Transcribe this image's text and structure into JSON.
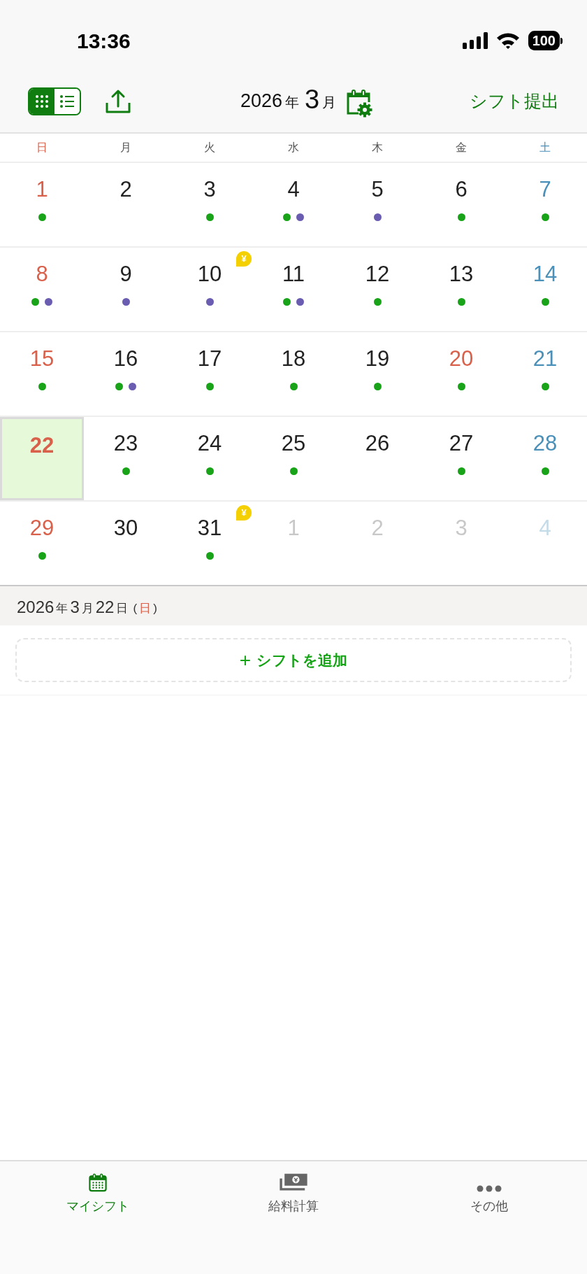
{
  "status_bar": {
    "time": "13:36",
    "battery": "100"
  },
  "header": {
    "view_toggle": [
      {
        "kind": "grid",
        "selected": true
      },
      {
        "kind": "list",
        "selected": false
      }
    ],
    "year": "2026",
    "year_unit": "年",
    "month": "3",
    "month_unit": "月",
    "submit": "シフト提出"
  },
  "weekdays": [
    {
      "label": "日",
      "kind": "sunday"
    },
    {
      "label": "月",
      "kind": "weekday"
    },
    {
      "label": "火",
      "kind": "weekday"
    },
    {
      "label": "水",
      "kind": "weekday"
    },
    {
      "label": "木",
      "kind": "weekday"
    },
    {
      "label": "金",
      "kind": "weekday"
    },
    {
      "label": "土",
      "kind": "saturday"
    }
  ],
  "days": [
    {
      "number": "1",
      "kind": "sunday",
      "in_month": true,
      "selected": false,
      "dots": [
        {
          "color": "#19a319"
        }
      ]
    },
    {
      "number": "2",
      "kind": "weekday",
      "in_month": true,
      "selected": false
    },
    {
      "number": "3",
      "kind": "weekday",
      "in_month": true,
      "selected": false,
      "dots": [
        {
          "color": "#19a319"
        }
      ]
    },
    {
      "number": "4",
      "kind": "weekday",
      "in_month": true,
      "selected": false,
      "dots": [
        {
          "color": "#19a319"
        },
        {
          "color": "#6a5cb0"
        }
      ]
    },
    {
      "number": "5",
      "kind": "weekday",
      "in_month": true,
      "selected": false,
      "dots": [
        {
          "color": "#6a5cb0"
        }
      ]
    },
    {
      "number": "6",
      "kind": "weekday",
      "in_month": true,
      "selected": false,
      "dots": [
        {
          "color": "#19a319"
        }
      ]
    },
    {
      "number": "7",
      "kind": "saturday",
      "in_month": true,
      "selected": false,
      "dots": [
        {
          "color": "#19a319"
        }
      ]
    },
    {
      "number": "8",
      "kind": "sunday",
      "in_month": true,
      "selected": false,
      "dots": [
        {
          "color": "#19a319"
        },
        {
          "color": "#6a5cb0"
        }
      ]
    },
    {
      "number": "9",
      "kind": "weekday",
      "in_month": true,
      "selected": false,
      "dots": [
        {
          "color": "#6a5cb0"
        }
      ]
    },
    {
      "number": "10",
      "kind": "weekday",
      "in_month": true,
      "selected": false,
      "badge": "¥",
      "dots": [
        {
          "color": "#6a5cb0"
        }
      ]
    },
    {
      "number": "11",
      "kind": "weekday",
      "in_month": true,
      "selected": false,
      "dots": [
        {
          "color": "#19a319"
        },
        {
          "color": "#6a5cb0"
        }
      ]
    },
    {
      "number": "12",
      "kind": "weekday",
      "in_month": true,
      "selected": false,
      "dots": [
        {
          "color": "#19a319"
        }
      ]
    },
    {
      "number": "13",
      "kind": "weekday",
      "in_month": true,
      "selected": false,
      "dots": [
        {
          "color": "#19a319"
        }
      ]
    },
    {
      "number": "14",
      "kind": "saturday",
      "in_month": true,
      "selected": false,
      "dots": [
        {
          "color": "#19a319"
        }
      ]
    },
    {
      "number": "15",
      "kind": "sunday",
      "in_month": true,
      "selected": false,
      "dots": [
        {
          "color": "#19a319"
        }
      ]
    },
    {
      "number": "16",
      "kind": "weekday",
      "in_month": true,
      "selected": false,
      "dots": [
        {
          "color": "#19a319"
        },
        {
          "color": "#6a5cb0"
        }
      ]
    },
    {
      "number": "17",
      "kind": "weekday",
      "in_month": true,
      "selected": false,
      "dots": [
        {
          "color": "#19a319"
        }
      ]
    },
    {
      "number": "18",
      "kind": "weekday",
      "in_month": true,
      "selected": false,
      "dots": [
        {
          "color": "#19a319"
        }
      ]
    },
    {
      "number": "19",
      "kind": "weekday",
      "in_month": true,
      "selected": false,
      "dots": [
        {
          "color": "#19a319"
        }
      ]
    },
    {
      "number": "20",
      "kind": "holiday",
      "in_month": true,
      "selected": false,
      "dots": [
        {
          "color": "#19a319"
        }
      ]
    },
    {
      "number": "21",
      "kind": "saturday",
      "in_month": true,
      "selected": false,
      "dots": [
        {
          "color": "#19a319"
        }
      ]
    },
    {
      "number": "22",
      "kind": "sunday",
      "in_month": true,
      "selected": true
    },
    {
      "number": "23",
      "kind": "weekday",
      "in_month": true,
      "selected": false,
      "dots": [
        {
          "color": "#19a319"
        }
      ]
    },
    {
      "number": "24",
      "kind": "weekday",
      "in_month": true,
      "selected": false,
      "dots": [
        {
          "color": "#19a319"
        }
      ]
    },
    {
      "number": "25",
      "kind": "weekday",
      "in_month": true,
      "selected": false,
      "dots": [
        {
          "color": "#19a319"
        }
      ]
    },
    {
      "number": "26",
      "kind": "weekday",
      "in_month": true,
      "selected": false
    },
    {
      "number": "27",
      "kind": "weekday",
      "in_month": true,
      "selected": false,
      "dots": [
        {
          "color": "#19a319"
        }
      ]
    },
    {
      "number": "28",
      "kind": "saturday",
      "in_month": true,
      "selected": false,
      "dots": [
        {
          "color": "#19a319"
        }
      ]
    },
    {
      "number": "29",
      "kind": "sunday",
      "in_month": true,
      "selected": false,
      "dots": [
        {
          "color": "#19a319"
        }
      ]
    },
    {
      "number": "30",
      "kind": "weekday",
      "in_month": true,
      "selected": false
    },
    {
      "number": "31",
      "kind": "weekday",
      "in_month": true,
      "selected": false,
      "badge": "¥",
      "dots": [
        {
          "color": "#19a319"
        }
      ]
    },
    {
      "number": "1",
      "kind": "weekday",
      "in_month": false,
      "selected": false
    },
    {
      "number": "2",
      "kind": "weekday",
      "in_month": false,
      "selected": false
    },
    {
      "number": "3",
      "kind": "weekday",
      "in_month": false,
      "selected": false
    },
    {
      "number": "4",
      "kind": "saturday",
      "in_month": false,
      "selected": false
    }
  ],
  "selected_date": {
    "year": "2026",
    "year_unit": "年",
    "month": "3",
    "month_unit": "月",
    "day": "22",
    "day_unit": "日",
    "open_paren": "(",
    "weekday": "日",
    "close_paren": ")"
  },
  "add_shift": {
    "icon": "+",
    "label": "シフトを追加"
  },
  "tab_bar": [
    {
      "kind": "calendar",
      "label": "マイシフト",
      "selected": true
    },
    {
      "kind": "money",
      "label": "給料計算",
      "selected": false
    },
    {
      "kind": "more",
      "label": "その他",
      "selected": false
    }
  ]
}
